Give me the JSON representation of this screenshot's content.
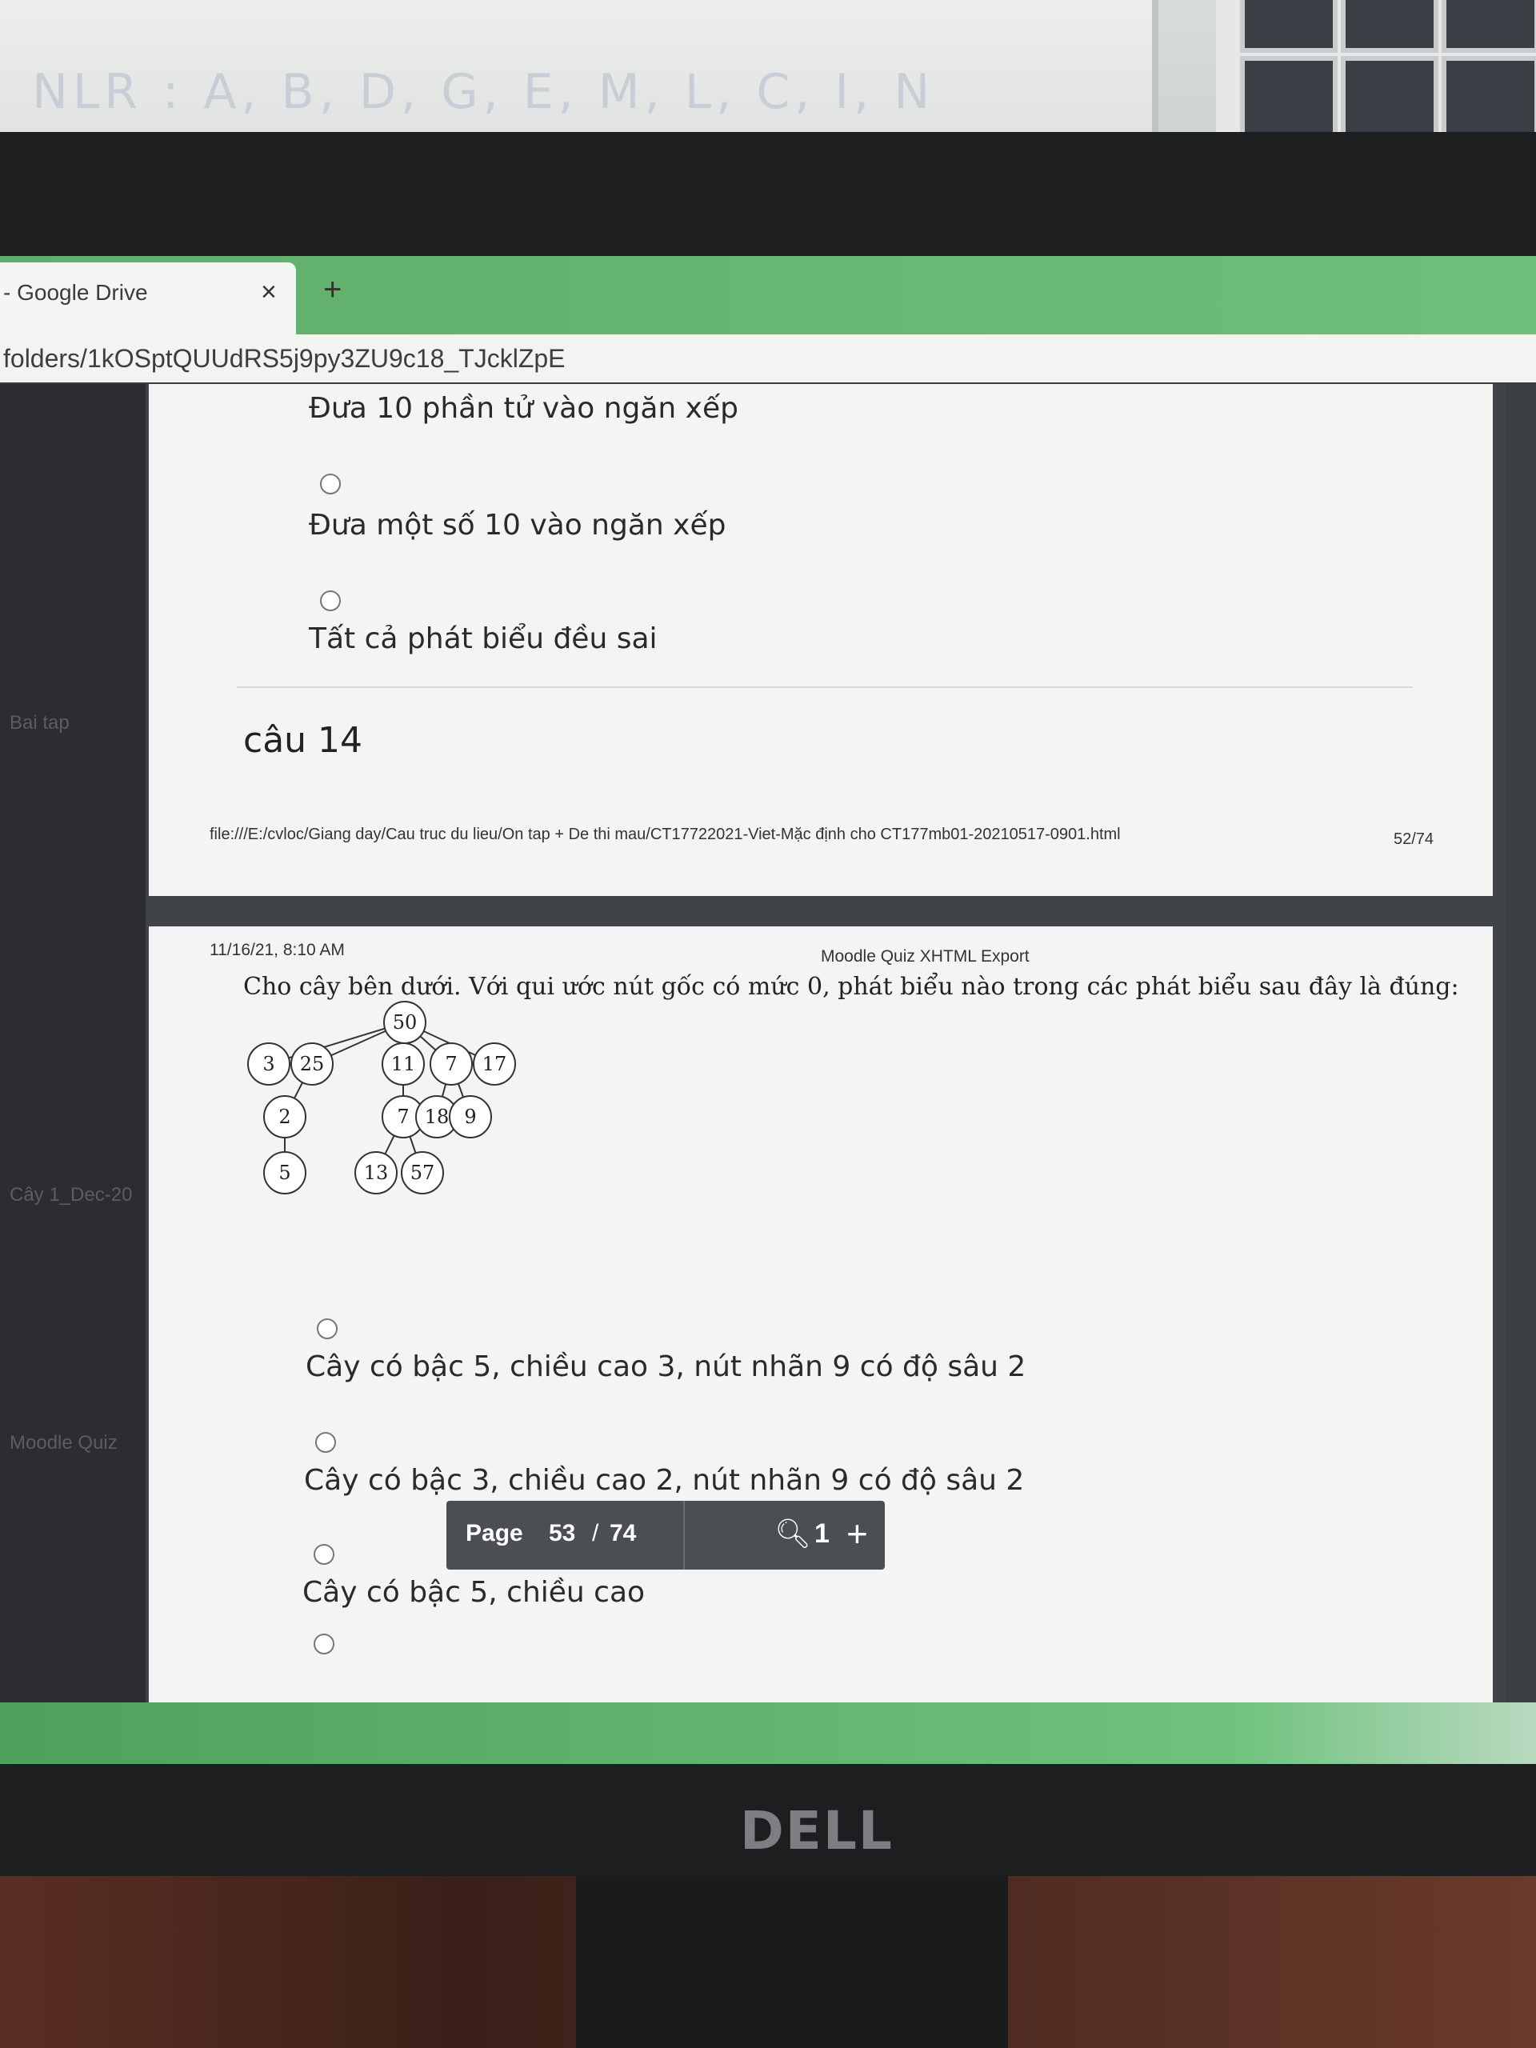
{
  "background": {
    "whiteboard_text": "NLR : A, B, D, G, E, M, L, C, I, N"
  },
  "browser": {
    "tab_title": "- Google Drive",
    "tab_close": "×",
    "new_tab": "+",
    "url": "folders/1kOSptQUUdRS5j9py3ZU9c18_TJcklZpE"
  },
  "sidebar": {
    "items": [
      "Bai tap",
      "Cây 1_Dec-20",
      "Moodle Quiz"
    ]
  },
  "page1": {
    "options": [
      "Đưa 10 phần tử vào ngăn xếp",
      "Đưa một số 10 vào ngăn xếp",
      "Tất cả phát biểu đều sai"
    ],
    "next_question_heading": "câu 14",
    "footer_path": "file:///E:/cvloc/Giang day/Cau truc du lieu/On tap + De thi mau/CT17722021-Viet-Mặc định cho CT177mb01-20210517-0901.html",
    "footer_page": "52/74"
  },
  "page2": {
    "header_date": "11/16/21, 8:10 AM",
    "header_title": "Moodle Quiz XHTML Export",
    "question": "Cho cây bên dưới. Với qui ước nút gốc có mức 0, phát biểu nào trong các phát biểu sau đây là đúng:",
    "tree_nodes": [
      "50",
      "3",
      "25",
      "11",
      "7",
      "17",
      "2",
      "7",
      "18",
      "9",
      "5",
      "13",
      "57"
    ],
    "answers": [
      "Cây có  bậc 5, chiều cao 3, nút nhãn 9 có độ sâu 2",
      "Cây có  bậc 3, chiều cao 2, nút nhãn 9 có độ sâu 2",
      "Cây có  bậc 5, chiều cao"
    ]
  },
  "pdf_toolbar": {
    "page_label": "Page",
    "current_page": "53",
    "separator": "/",
    "total_pages": "74",
    "zoom_icon": "zoom-icon",
    "zoom_level": "1",
    "zoom_in": "+"
  },
  "monitor_brand": "DELL"
}
